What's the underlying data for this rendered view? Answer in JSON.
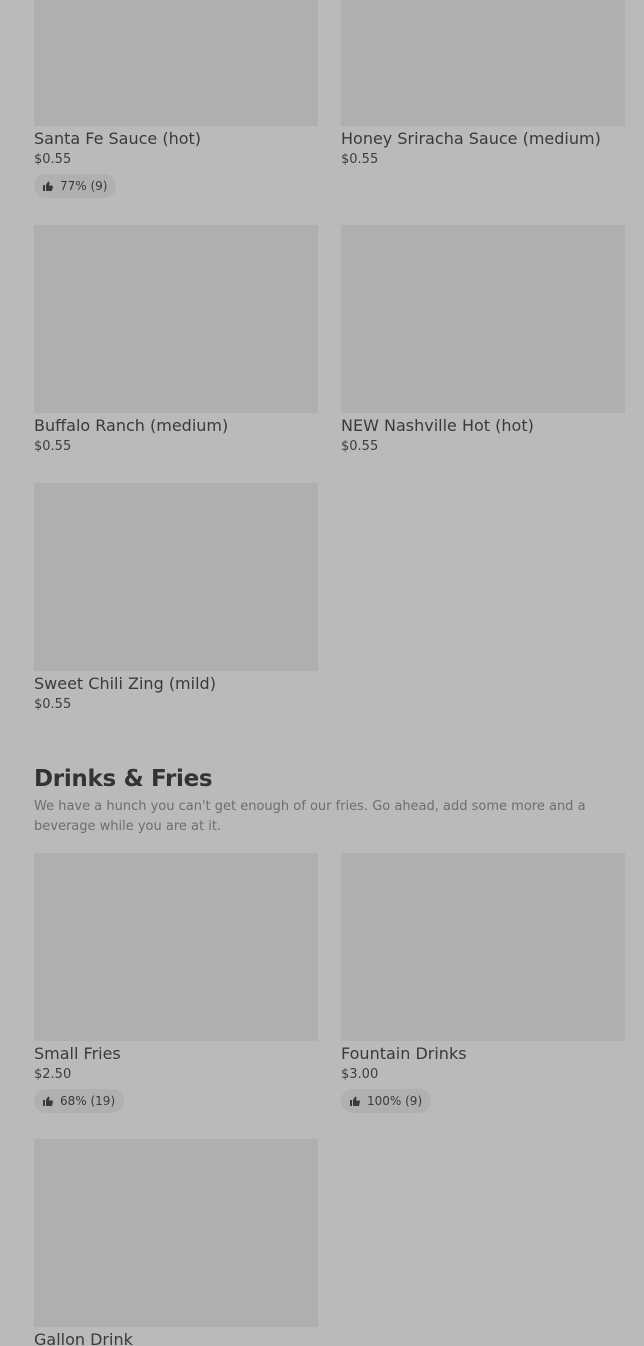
{
  "items": [
    {
      "name": "Santa Fe Sauce (hot)",
      "price": "$0.55",
      "rating": "77% (9)"
    },
    {
      "name": "Honey Sriracha Sauce (medium)",
      "price": "$0.55"
    },
    {
      "name": "Buffalo Ranch (medium)",
      "price": "$0.55"
    },
    {
      "name": "NEW Nashville Hot (hot)",
      "price": "$0.55"
    },
    {
      "name": "Sweet Chili Zing (mild)",
      "price": "$0.55"
    }
  ],
  "section": {
    "title": "Drinks & Fries",
    "description": "We have a hunch you can't get enough of our fries. Go ahead, add some more and a beverage while you are at it.",
    "items": [
      {
        "name": "Small Fries",
        "price": "$2.50",
        "rating": "68% (19)"
      },
      {
        "name": "Fountain Drinks",
        "price": "$3.00",
        "rating": "100% (9)"
      },
      {
        "name": "Gallon Drink"
      }
    ]
  },
  "icons": {
    "rating": "thumbs-up-icon"
  },
  "colors": {
    "background": "#bababa",
    "image_placeholder": "#afafaf",
    "badge": "#b0b0b0"
  }
}
